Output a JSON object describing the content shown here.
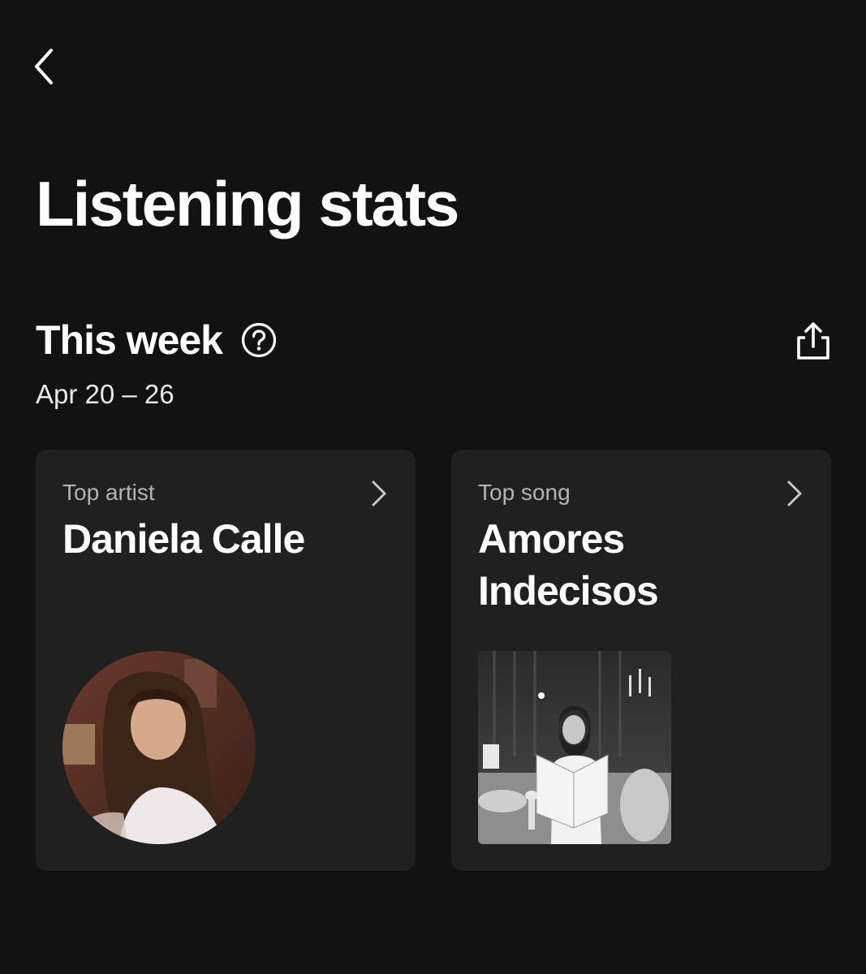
{
  "header": {
    "back_icon": "chevron-left-icon",
    "title": "Listening stats"
  },
  "section": {
    "title": "This week",
    "help_icon": "question-circle-icon",
    "share_icon": "share-icon",
    "date_range": "Apr 20 – 26"
  },
  "cards": {
    "artist": {
      "label": "Top artist",
      "value": "Daniela Calle",
      "image": "artist-photo"
    },
    "song": {
      "label": "Top song",
      "value": "Amores Indecisos",
      "image": "album-art"
    }
  },
  "colors": {
    "background": "#121212",
    "card": "#202020",
    "text_primary": "#ffffff",
    "text_secondary": "#b3b3b3"
  }
}
